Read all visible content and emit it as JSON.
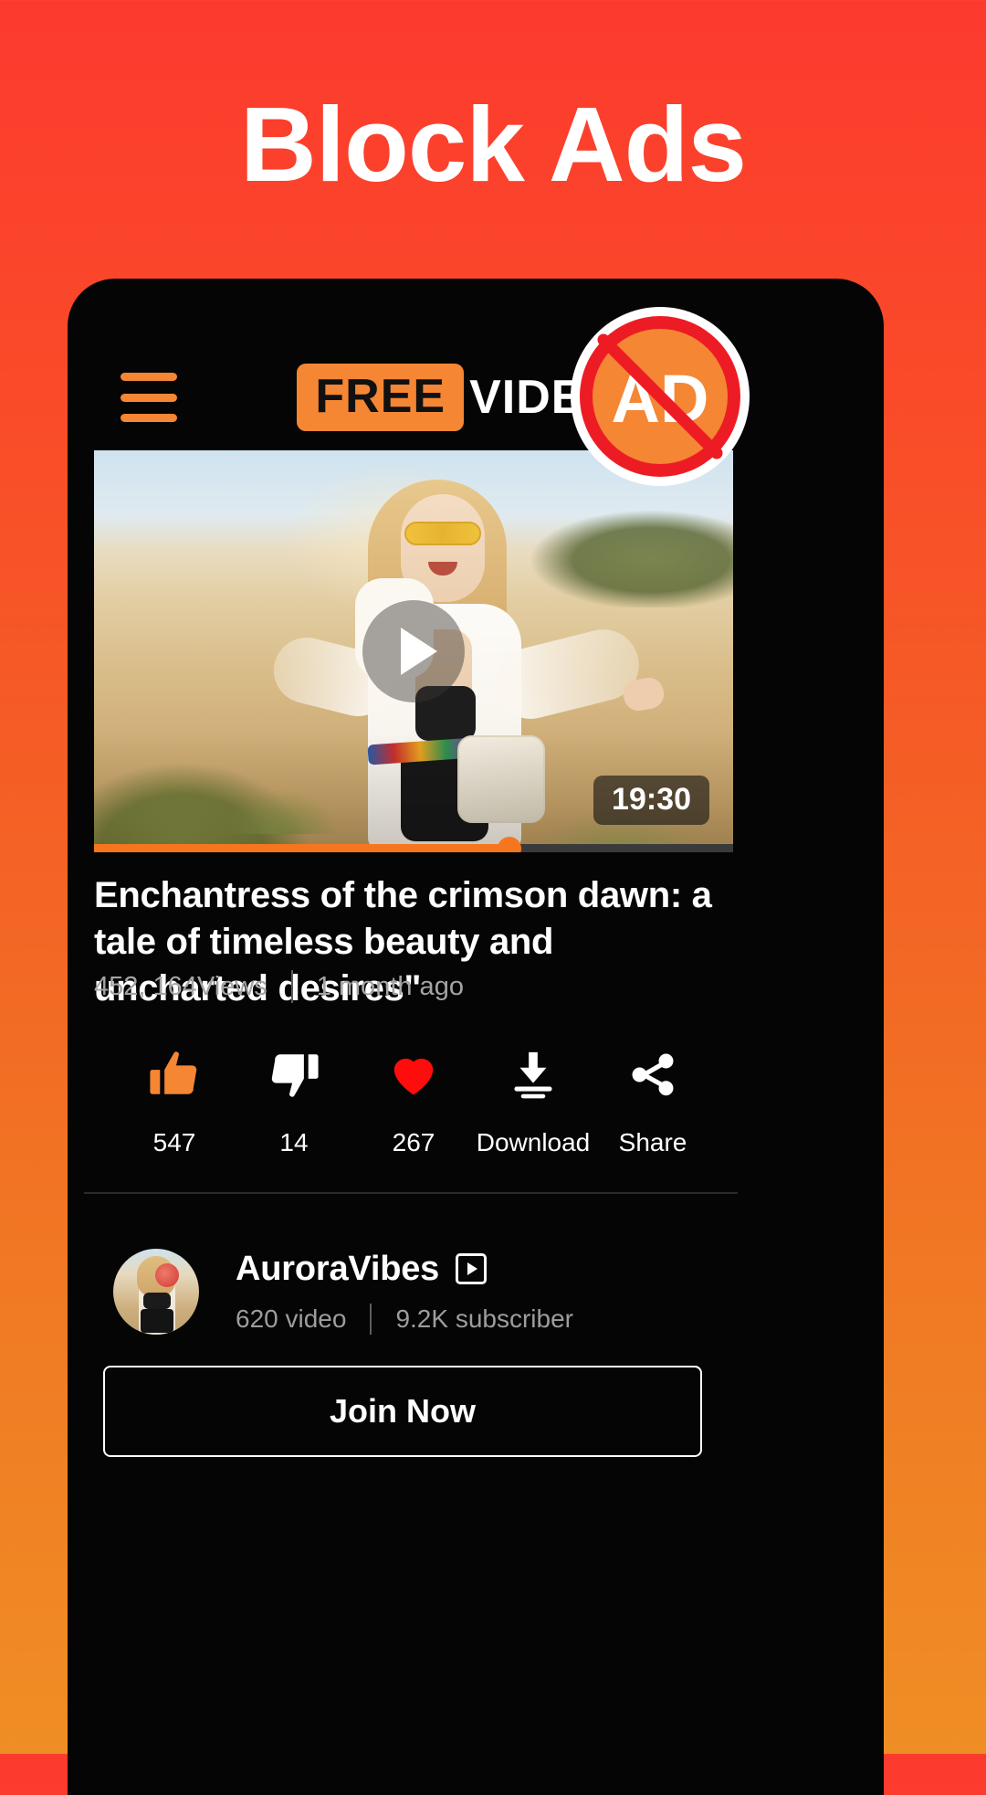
{
  "promo": {
    "headline": "Block Ads",
    "bg_gradient_from": "#FC3A2E",
    "bg_gradient_to": "#EF8E24"
  },
  "app": {
    "header": {
      "menu_icon": "hamburger-menu-icon",
      "brand_highlight": "FREE",
      "brand_rest": "VIDEOS",
      "brand_badge_color": "#F58634"
    },
    "ad_badge": {
      "label": "AD",
      "ring_color": "#ED1C24",
      "fill_color": "#F58634",
      "icon": "no-ads-blocked-icon"
    },
    "player": {
      "play_icon": "play-icon",
      "duration": "19:30",
      "progress_percent": 65,
      "progress_color": "#F5761F"
    },
    "video": {
      "title": "Enchantress of the crimson dawn: a tale of timeless beauty and uncharted desires\"",
      "views": "452, 164Views",
      "age": "1 month ago"
    },
    "actions": [
      {
        "icon": "thumbs-up-icon",
        "label": "547",
        "color": "#F58634",
        "name": "like-action"
      },
      {
        "icon": "thumbs-down-icon",
        "label": "14",
        "color": "#FFFFFF",
        "name": "dislike-action"
      },
      {
        "icon": "heart-icon",
        "label": "267",
        "color": "#FF0D0D",
        "name": "favorite-action"
      },
      {
        "icon": "download-icon",
        "label": "Download",
        "color": "#FFFFFF",
        "name": "download-action"
      },
      {
        "icon": "share-icon",
        "label": "Share",
        "color": "#FFFFFF",
        "name": "share-action"
      }
    ],
    "channel": {
      "name": "AuroraVibes",
      "verified_icon": "play-box-icon",
      "videos": "620 video",
      "subscribers": "9.2K subscriber",
      "avatar": "channel-avatar"
    },
    "join_button": "Join Now"
  }
}
